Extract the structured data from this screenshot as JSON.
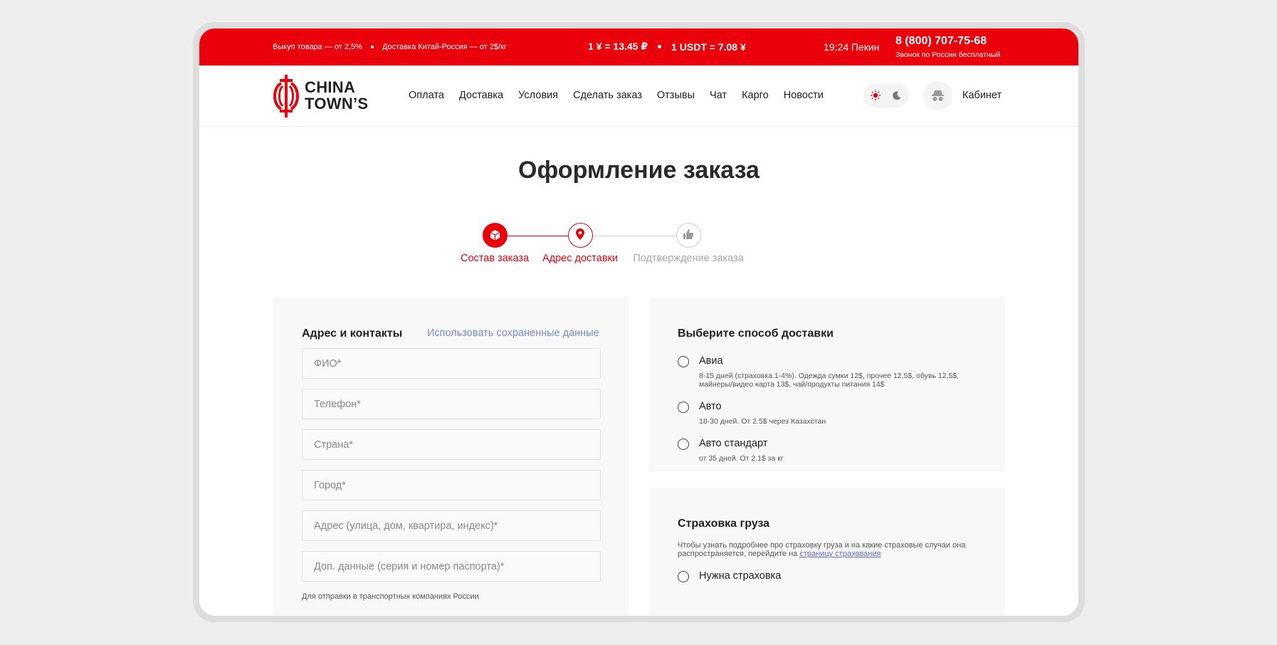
{
  "topbar": {
    "promo": [
      "Выкуп товара — от 2,5%",
      "Доставка Китай-Россия — от 2$/кг"
    ],
    "rates": [
      "1 ¥ = 13.45 ₽",
      "1 USDT = 7.08 ¥"
    ],
    "time": "19:24 Пекин",
    "phone": "8 (800) 707-75-68",
    "phone_note": "Звонок по России бесплатный"
  },
  "logo": {
    "line1": "CHINA",
    "line2": "TOWN’S"
  },
  "nav": [
    "Оплата",
    "Доставка",
    "Условия",
    "Сделать заказ",
    "Отзывы",
    "Чат",
    "Карго",
    "Новости"
  ],
  "cabinet": "Кабинет",
  "page_title": "Оформление заказа",
  "steps": [
    {
      "label": "Состав заказа",
      "state": "done"
    },
    {
      "label": "Адрес доставки",
      "state": "current"
    },
    {
      "label": "Подтверждение заказа",
      "state": "pending"
    }
  ],
  "address": {
    "title": "Адрес и контакты",
    "use_saved": "Использовать сохраненные данные",
    "fields": [
      "ФИО*",
      "Телефон*",
      "Страна*",
      "Город*",
      "Адрес (улица, дом, квартира, индекс)*",
      "Доп. данные (серия и номер паспорта)*"
    ],
    "hint": "Для отправки в транспортных компаниях России"
  },
  "delivery": {
    "title": "Выберите способ доставки",
    "options": [
      {
        "label": "Авиа",
        "desc": "8-15 дней (страховка 1-4%). Одежда сумки 12$, прочее 12,5$, обувь 12,5$, майнеры/видео карта 13$, чай/продукты питания 14$"
      },
      {
        "label": "Авто",
        "desc": "18-30 дней. От 2.5$ через Казахстан"
      },
      {
        "label": "Авто стандарт",
        "desc": "от 35 дней. От 2.1$ за кг"
      }
    ]
  },
  "insurance": {
    "title": "Страховка груза",
    "desc": "Чтобы узнать подробнее про страховку груза и на какие страховые случаи она распространяется, перейдите на",
    "link": "страницу страхования",
    "option": "Нужна страховка"
  },
  "colors": {
    "accent": "#e9000b",
    "link": "#7a8bd1",
    "card_bg": "#f8f8f8"
  }
}
